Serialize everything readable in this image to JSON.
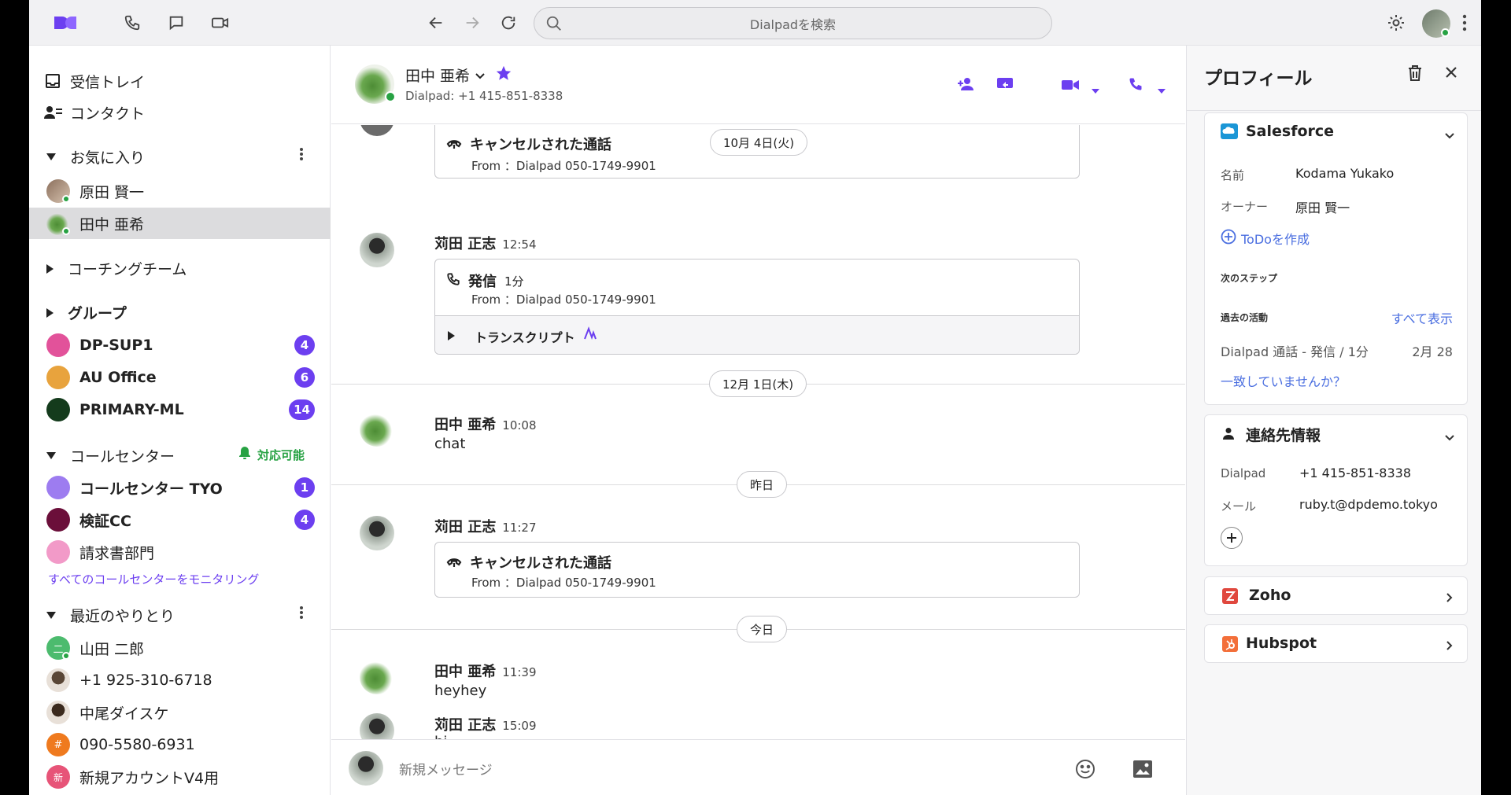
{
  "topbar": {
    "search_placeholder": "Dialpadを検索"
  },
  "sidebar": {
    "inbox": "受信トレイ",
    "contacts": "コンタクト",
    "favorites_title": "お気に入り",
    "favorites": [
      {
        "name": "原田 賢一"
      },
      {
        "name": "田中 亜希"
      }
    ],
    "coaching": "コーチングチーム",
    "groups_title": "グループ",
    "groups": [
      {
        "name": "DP-SUP1",
        "count": "4",
        "color": "#e2529a"
      },
      {
        "name": "AU Office",
        "count": "6",
        "color": "#e8a33d"
      },
      {
        "name": "PRIMARY-ML",
        "count": "14",
        "color": "#143b1c"
      }
    ],
    "callcenter_title": "コールセンター",
    "callcenter_status": "対応可能",
    "callcenters": [
      {
        "name": "コールセンター TYO",
        "count": "1",
        "color": "#9d7cf0"
      },
      {
        "name": "検証CC",
        "count": "4",
        "color": "#6b0f3a"
      },
      {
        "name": "請求書部門",
        "count": "",
        "color": "#f29ac8"
      }
    ],
    "monitor_link": "すべてのコールセンターをモニタリング",
    "recent_title": "最近のやりとり",
    "recent": [
      {
        "name": "山田 二郎",
        "initial": "二",
        "color": "#4cbb6e"
      },
      {
        "name": "+1 925-310-6718",
        "initial": "",
        "color": "#6e5a46"
      },
      {
        "name": "中尾ダイスケ",
        "initial": "",
        "color": "#6e5a46"
      },
      {
        "name": "090-5580-6931",
        "initial": "#",
        "color": "#ef7a1e"
      },
      {
        "name": "新規アカウントV4用",
        "initial": "新",
        "color": "#e75478"
      }
    ]
  },
  "conversation": {
    "contact_name": "田中 亜希",
    "contact_number": "Dialpad: +1 415-851-8338",
    "messages": {
      "c1_title": "キャンセルされた通話",
      "c1_sub": "From ：Dialpad 050-1749-9901",
      "d1": "10月 4日(火)",
      "m1_name": "苅田 正志",
      "m1_time": "12:54",
      "c2_title": "発信",
      "c2_dur": "1分",
      "c2_sub": "From ：Dialpad 050-1749-9901",
      "c2_transcript": "トランスクリプト",
      "d2": "12月 1日(木)",
      "m2_name": "田中 亜希",
      "m2_time": "10:08",
      "m2_text": "chat",
      "d3": "昨日",
      "m3_name": "苅田 正志",
      "m3_time": "11:27",
      "c3_title": "キャンセルされた通話",
      "c3_sub": "From ：Dialpad 050-1749-9901",
      "d4": "今日",
      "m4_name": "田中 亜希",
      "m4_time": "11:39",
      "m4_text": "heyhey",
      "m5_name": "苅田 正志",
      "m5_time": "15:09",
      "m5_text": "hi"
    },
    "composer_placeholder": "新規メッセージ"
  },
  "profile": {
    "title": "プロフィール",
    "salesforce": {
      "title": "Salesforce",
      "name_label": "名前",
      "name_value": "Kodama Yukako",
      "owner_label": "オーナー",
      "owner_value": "原田 賢一",
      "create_todo": "ToDoを作成",
      "next_steps": "次のステップ",
      "past_activity": "過去の活動",
      "show_all": "すべて表示",
      "activity_text": "Dialpad 通話 - 発信 / 1分",
      "activity_date": "2月 28",
      "mismatch": "一致していませんか？"
    },
    "contact_info": {
      "title": "連絡先情報",
      "dialpad_label": "Dialpad",
      "dialpad_value": "+1 415-851-8338",
      "mail_label": "メール",
      "mail_value": "ruby.t@dpdemo.tokyo"
    },
    "zoho": "Zoho",
    "hubspot": "Hubspot"
  },
  "colors": {
    "accent": "#6c3ff0",
    "link": "#4a6ee0",
    "online": "#27a243"
  }
}
